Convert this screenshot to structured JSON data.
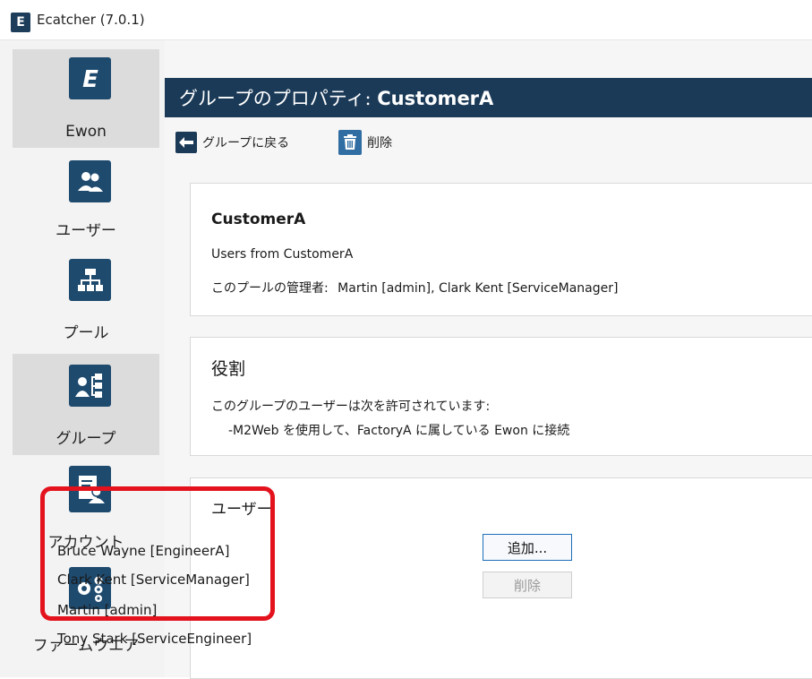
{
  "window": {
    "title": "Ecatcher (7.0.1)",
    "app_icon_letter": "E"
  },
  "sidebar": {
    "items": [
      {
        "label": "Ewon",
        "icon": "ewon-logo-icon",
        "active": false
      },
      {
        "label": "ユーザー",
        "icon": "users-icon",
        "active": false
      },
      {
        "label": "プール",
        "icon": "pool-tree-icon",
        "active": false
      },
      {
        "label": "グループ",
        "icon": "group-icon",
        "active": true
      },
      {
        "label": "アカウント",
        "icon": "account-icon",
        "active": false
      },
      {
        "label": "ファームウエア",
        "icon": "firmware-gears-icon",
        "active": false
      }
    ]
  },
  "header": {
    "prefix": "グループのプロパティ: ",
    "name": "CustomerA"
  },
  "toolbar": {
    "back_label": "グループに戻る",
    "delete_label": "削除"
  },
  "info_card": {
    "name": "CustomerA",
    "description": "Users from CustomerA",
    "admins_label": "このプールの管理者:",
    "admins_value": "Martin [admin], Clark Kent [ServiceManager]"
  },
  "role_card": {
    "title": "役割",
    "text": "このグループのユーザーは次を許可されています:",
    "permission": "-M2Web を使用して、FactoryA に属している Ewon に接続"
  },
  "users_card": {
    "title": "ユーザー",
    "users": [
      "Bruce Wayne [EngineerA]",
      "Clark Kent [ServiceManager]",
      "Martin [admin]",
      "Tony Stark [ServiceEngineer]"
    ],
    "add_button": "追加...",
    "remove_button": "削除"
  },
  "colors": {
    "navy": "#1b3a57",
    "highlight": "#e3121c"
  }
}
